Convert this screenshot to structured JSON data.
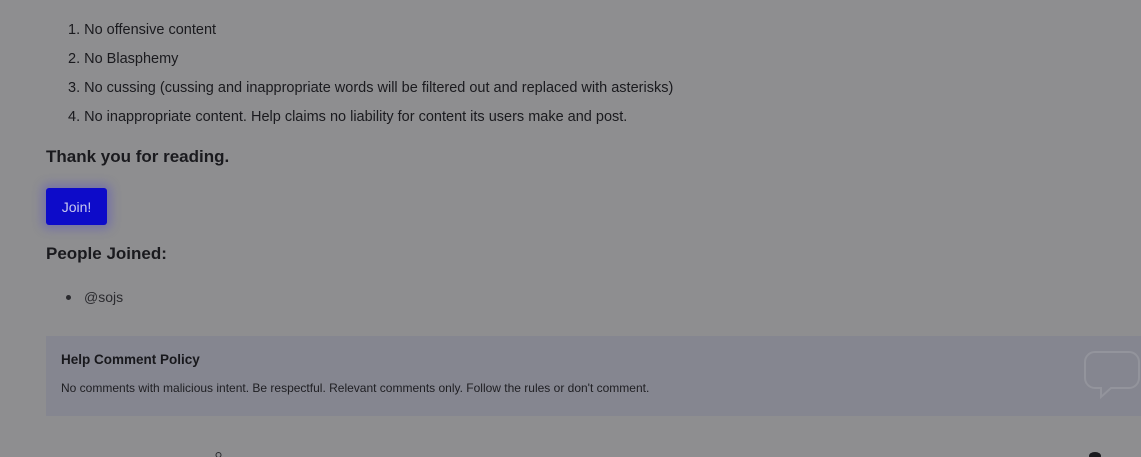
{
  "rules": [
    "1. No offensive content",
    "2. No Blasphemy",
    "3. No cussing (cussing and inappropriate words will be filtered out and replaced with asterisks)",
    "4. No inappropriate content. Help claims no liability for content its users make and post."
  ],
  "thanks_text": "Thank you for reading.",
  "join_button_label": "Join!",
  "joined_heading": "People Joined:",
  "joined_users": [
    "@sojs"
  ],
  "policy": {
    "title": "Help Comment Policy",
    "text": "No comments with malicious intent. Be respectful. Relevant comments only. Follow the rules or don't comment.",
    "icon": "speech-bubble-icon"
  },
  "colors": {
    "overlay_background": "#8e8e90",
    "join_button": "#0d0bc9",
    "policy_background": "#858690"
  }
}
